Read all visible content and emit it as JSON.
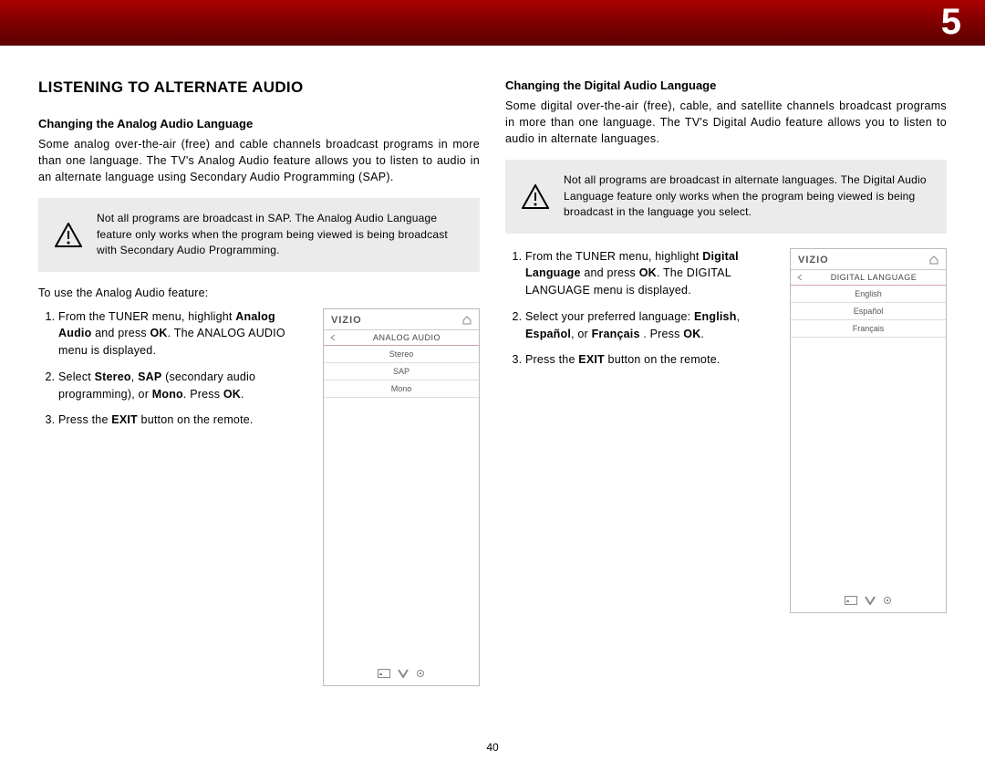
{
  "chapter_number": "5",
  "page_number": "40",
  "left": {
    "title": "LISTENING TO ALTERNATE AUDIO",
    "sub": "Changing the Analog Audio Language",
    "paragraph": "Some analog over-the-air (free) and cable channels broadcast programs in more than one language. The TV's Analog Audio feature allows you to listen to audio in an alternate language using Secondary Audio Programming (SAP).",
    "note": "Not all programs are broadcast in SAP. The Analog Audio Language feature only works when the program being viewed is being broadcast with Secondary Audio Programming.",
    "lead": "To use the Analog Audio feature:",
    "steps": {
      "s1a": "From the TUNER menu, highlight ",
      "s1b": "Analog Audio",
      "s1c": " and press ",
      "s1d": "OK",
      "s1e": ". The ANALOG AUDIO menu is displayed.",
      "s2a": "Select ",
      "s2b": "Stereo",
      "s2c": ", ",
      "s2d": "SAP",
      "s2e": " (secondary audio programming), or ",
      "s2f": "Mono",
      "s2g": ". Press ",
      "s2h": "OK",
      "s2i": ".",
      "s3a": "Press the ",
      "s3b": "EXIT",
      "s3c": " button on the remote."
    },
    "menu": {
      "brand": "VIZIO",
      "title": "ANALOG AUDIO",
      "items": [
        "Stereo",
        "SAP",
        "Mono"
      ]
    }
  },
  "right": {
    "sub": "Changing the Digital Audio Language",
    "paragraph": "Some digital over-the-air (free), cable, and satellite channels broadcast programs in more than one language. The TV's Digital Audio feature allows you to listen to audio in alternate languages.",
    "note": "Not all programs are broadcast in alternate languages. The Digital Audio Language feature only works when the program being viewed is being broadcast in the language you select.",
    "steps": {
      "s1a": "From the TUNER menu, highlight ",
      "s1b": "Digital Language",
      "s1c": " and press ",
      "s1d": "OK",
      "s1e": ". The DIGITAL LANGUAGE menu is displayed.",
      "s2a": "Select your preferred language: ",
      "s2b": "English",
      "s2c": ", ",
      "s2d": "Español",
      "s2e": ",  or ",
      "s2f": "Français",
      "s2g": " . Press ",
      "s2h": "OK",
      "s2i": ".",
      "s3a": "Press the ",
      "s3b": "EXIT",
      "s3c": " button on the remote."
    },
    "menu": {
      "brand": "VIZIO",
      "title": "DIGITAL LANGUAGE",
      "items": [
        "English",
        "Español",
        "Français"
      ]
    }
  }
}
